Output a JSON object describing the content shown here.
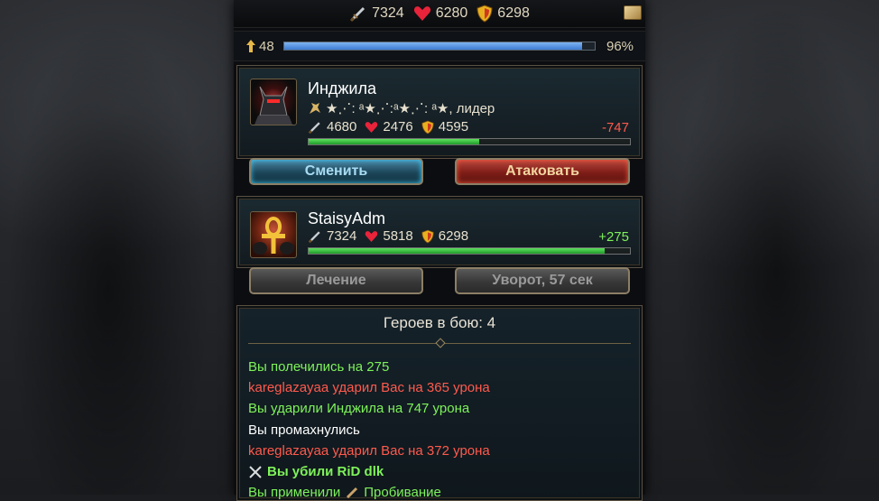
{
  "topbar": {
    "attack": "7324",
    "health": "6280",
    "armor": "6298",
    "icons": [
      "sword-icon",
      "heart-icon",
      "shield-icon",
      "mail-icon"
    ]
  },
  "level": {
    "value": "48",
    "percent_label": "96%",
    "progress": 0.96
  },
  "enemy": {
    "name": "Инджила",
    "rank_text": "★⋰: ᵃ★⋰:ᵃ★⋰: ᵃ★, лидер",
    "attack": "4680",
    "health": "2476",
    "armor": "4595",
    "delta": "-747",
    "hp_fraction": 0.53
  },
  "enemy_actions": {
    "switch_label": "Сменить",
    "attack_label": "Атаковать"
  },
  "player": {
    "name": "StaisyAdm",
    "attack": "7324",
    "health": "5818",
    "armor": "6298",
    "delta": "+275",
    "hp_fraction": 0.92
  },
  "player_actions": {
    "heal_label": "Лечение",
    "dodge_label": "Уворот, 57 сек"
  },
  "battle_log": {
    "title": "Героев в бою: 4",
    "lines": [
      {
        "text": "Вы полечились на 275",
        "color": "green"
      },
      {
        "text": "kareglazayaa ударил Вас на 365 урона",
        "color": "red"
      },
      {
        "text": "Вы ударили Инджила на 747 урона",
        "color": "green"
      },
      {
        "text": "Вы промахнулись",
        "color": "white"
      },
      {
        "text": "kareglazayaa ударил Вас на 372 урона",
        "color": "red"
      },
      {
        "text": "Вы убили RiD dlk",
        "color": "green",
        "bold": true
      },
      {
        "text": "Вы применили",
        "color": "green"
      },
      {
        "text": "Пробивание",
        "color": "green"
      }
    ]
  },
  "colors": {
    "green": "#7ef25a",
    "red": "#ff5a4d",
    "gold": "#e0d7c0",
    "xp_blue": "#3d7bd3",
    "hp_green": "#1f9a2a"
  }
}
